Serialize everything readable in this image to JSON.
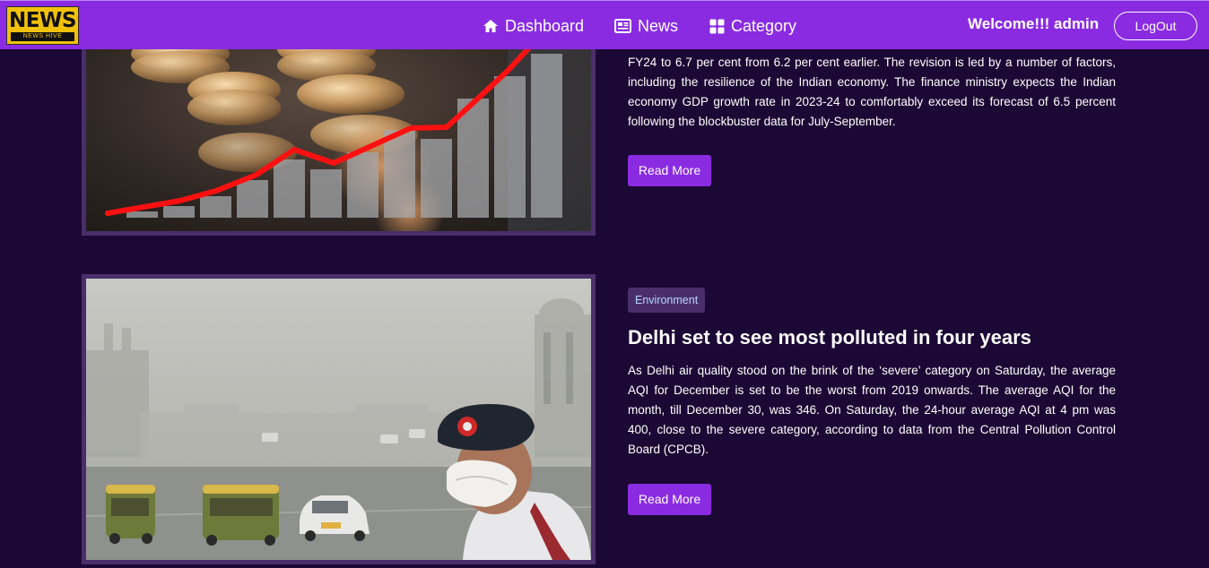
{
  "navbar": {
    "logo": {
      "title": "NEWS",
      "subtitle": "NEWS HIVE"
    },
    "links": [
      {
        "label": "Dashboard",
        "icon": "home-icon"
      },
      {
        "label": "News",
        "icon": "newspaper-icon"
      },
      {
        "label": "Category",
        "icon": "grid-icon"
      }
    ],
    "welcome": "Welcome!!! admin",
    "logout_label": "LogOut"
  },
  "articles": [
    {
      "image": "coins-growth-chart-image",
      "body": "FY24 to 6.7 per cent from 6.2 per cent earlier. The revision is led by a number of factors, including the resilience of the Indian economy. The finance ministry expects the Indian economy GDP growth rate in 2023-24 to comfortably exceed its forecast of 6.5 percent following the blockbuster data for July-September.",
      "read_more": "Read More"
    },
    {
      "image": "delhi-smog-policeman-image",
      "category": "Environment",
      "title": "Delhi set to see most polluted in four years",
      "body": "As Delhi air quality stood on the brink of the ‘severe’ category on Saturday, the average AQI for December is set to be the worst from 2019 onwards. The average AQI for the month, till December 30, was 346. On Saturday, the 24-hour average AQI at 4 pm was 400, close to the severe category, according to data from the Central Pollution Control Board (CPCB).",
      "read_more": "Read More"
    }
  ],
  "colors": {
    "navbar": "#8a2be2",
    "page_background": "#1c0834",
    "button": "#8a2be2",
    "badge_background": "#4a2e6b",
    "badge_text": "#b6d6ff",
    "image_border": "#4a2e6b"
  }
}
